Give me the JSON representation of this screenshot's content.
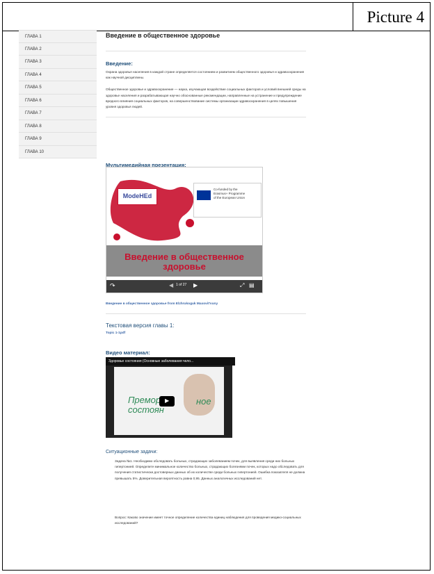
{
  "picture_label": "Picture 4",
  "sidebar": {
    "items": [
      "ГЛАВА 1",
      "ГЛАВА 2",
      "ГЛАВА 3",
      "ГЛАВА 4",
      "ГЛАВА 5",
      "ГЛАВА 6",
      "ГЛАВА 7",
      "ГЛАВА 8",
      "ГЛАВА 9",
      "ГЛАВА 10"
    ]
  },
  "main": {
    "title": "Введение в общественное здоровье",
    "intro_heading": "Введение:",
    "intro_p1": "Охрана здоровья населения в каждой стране определяется состоянием и развитием общественного здоровья и здравоохранения как научной дисциплины.",
    "intro_p2": "Общественное здоровье и здравоохранение — наука, изучающая воздействие социальных факторов и условий внешней среды на здоровье населения и разрабатывающая научно обоснованные рекомендации, направленные на устранение и предупреждение вредного влияния социальных факторов, на совершенствование системы организации здравоохранения в целях повышения уровня здоровья людей.",
    "multimedia_heading": "Мультимедийная презентация:",
    "slide": {
      "logo_text": "ModeHEd",
      "eu_text_1": "Co-funded by the",
      "eu_text_2": "Erasmus+ Programme",
      "eu_text_3": "of the European Union",
      "caption_1": "Введение в общественное",
      "caption_2": "здоровье",
      "counter": "1 of 27"
    },
    "slide_link": "Введение в общественное здоровье from Elzhrukoguk Maxovit'vuny",
    "text_version_heading": "Текстовая версия главы 1:",
    "text_version_link": "Topic 1-1pdf",
    "video_heading": "Видео материал:",
    "video": {
      "title": "Здоровье состояния (Основные заболевания чело...",
      "overlay_text_1": "Премор",
      "overlay_text_2": "состоян",
      "overlay_text_3": "ное"
    },
    "situational_heading": "Ситуационные задачи:",
    "task_p1": "Задача №1. Необходимо обследовать больных, страдающих заболеванием почек, для выявления среди них больных гипертонией. Определите минимальное количество больных, страдающих болезнями почек, которых надо обследовать для получения статистически достоверных данных об их количестве среди больных гипертонией. Ошибка показателя не должна превышать 5%. Доверительная вероятность равна 0,95. Данных аналогичных исследований нет.",
    "task_p2": "Вопрос: Каково значение имеет точное определение количества единиц наблюдения для проведения медико-социальных исследований?"
  },
  "colors": {
    "heading_blue": "#1f4e79",
    "slide_red": "#c8102e",
    "eu_blue": "#003399"
  }
}
